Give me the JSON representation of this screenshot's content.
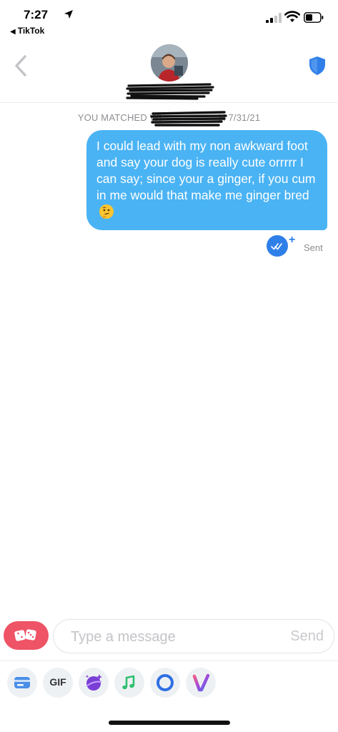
{
  "status_bar": {
    "time": "7:27",
    "back_app": "TikTok"
  },
  "header": {
    "avatar_icon": "profile-photo",
    "safety_icon": "shield-icon"
  },
  "conversation": {
    "match_prefix": "YOU MATCHED WI",
    "match_suffix": "H 7/31/21",
    "message_text": "I could lead with my non awkward foot and say your dog is really cute orrrrr I can say; since your a ginger, if you cum in me would that make me ginger bred",
    "message_emoji": "thinking-face-emoji",
    "read_receipt_icon": "double-check-icon",
    "receipt_plus": "+",
    "status": "Sent"
  },
  "composer": {
    "placeholder": "Type a message",
    "send_label": "Send",
    "dice_icon": "dice-icon"
  },
  "toolbar": {
    "gif_label": "GIF",
    "icons": [
      "card-icon",
      "gif-icon",
      "sparkle-planet-icon",
      "music-note-icon",
      "circle-ring-icon",
      "v-logo-icon"
    ]
  },
  "colors": {
    "bubble": "#4ab3f4",
    "receipt": "#2f7fe8",
    "dice": "#ee5366",
    "shield": "#2f7fe8"
  }
}
